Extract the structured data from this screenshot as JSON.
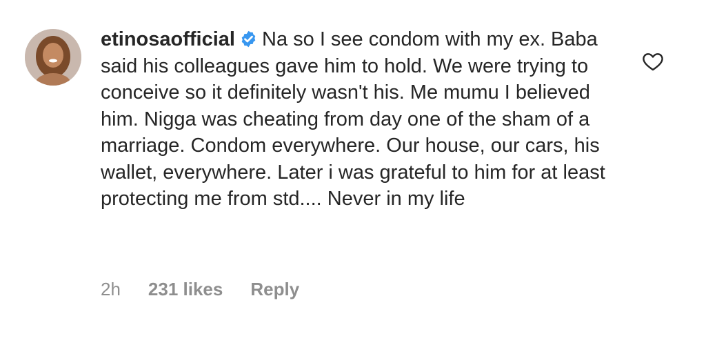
{
  "comment": {
    "username": "etinosaofficial",
    "verified_icon": "verified-badge-icon",
    "text": "Na so I see condom with my ex. Baba said his colleagues gave him to hold. We were trying to conceive so it definitely wasn't his. Me mumu I believed him. Nigga was cheating from day one of the sham of a marriage. Condom everywhere. Our house, our cars, his wallet, everywhere. Later i was grateful to him for at least protecting me from std.... Never in my life",
    "time": "2h",
    "likes": "231 likes",
    "reply_label": "Reply",
    "like_icon": "heart-outline-icon",
    "colors": {
      "text": "#262626",
      "meta": "#8e8e8e",
      "verified": "#3897f0"
    }
  }
}
